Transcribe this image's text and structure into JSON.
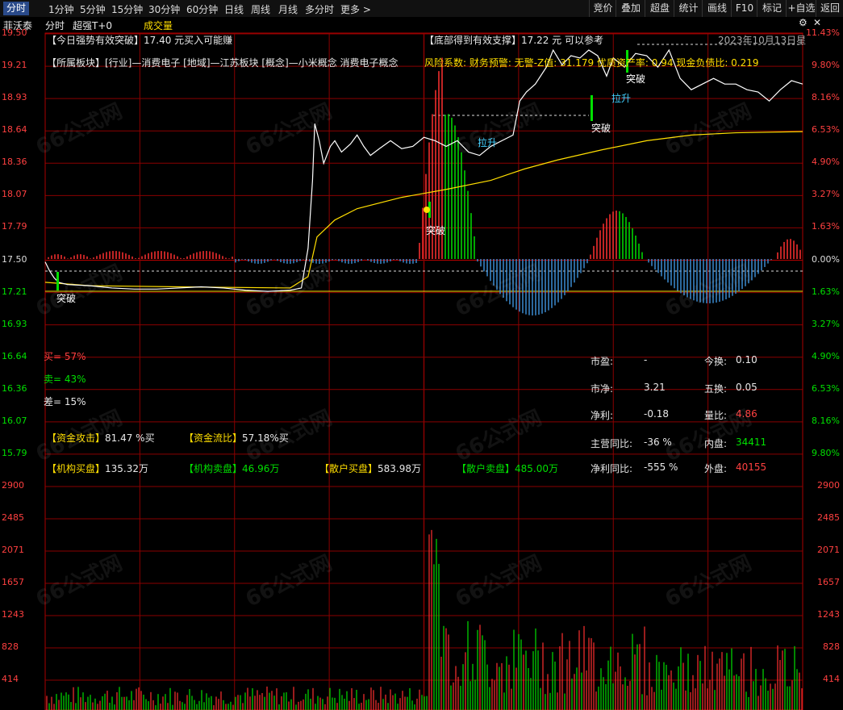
{
  "toolbar": {
    "tabs": [
      "分时",
      "1分钟",
      "5分钟",
      "15分钟",
      "30分钟",
      "60分钟",
      "日线",
      "周线",
      "月线",
      "多分时",
      "更多 >"
    ],
    "right_buttons": [
      "竞价",
      "叠加",
      "超盘",
      "统计",
      "画线",
      "F10",
      "标记",
      "+自选",
      "返回"
    ]
  },
  "subbar": {
    "stock": "菲沃泰",
    "mode": "分时",
    "indicator": "超强T+0",
    "volume_label": "成交量"
  },
  "icons": {
    "settings": "gear-icon",
    "close": "close-icon",
    "arrow": "chevron-right-icon"
  },
  "main": {
    "signal_left": "【今日强势有效突破】17.40 元买入可能赚",
    "signal_right": "【底部得到有效支撑】17.22 元 可以参考",
    "date": "2023年10月13日星",
    "sector": "【所属板块】[行业]—消费电子 [地域]—江苏板块 [概念]—小米概念 消费电子概念",
    "risk": "风险系数: 财务预警: 无警-Z值: 31.179 优质资产率: 0.94 现金负债比: 0.219",
    "breakout_labels": [
      "突破",
      "突破",
      "突破",
      "突破"
    ],
    "pull_labels": [
      "拉升",
      "拉升"
    ]
  },
  "price_axis": {
    "left": [
      "19.50",
      "19.21",
      "18.93",
      "18.64",
      "18.36",
      "18.07",
      "17.79",
      "17.50",
      "17.21",
      "16.93",
      "16.64",
      "16.36",
      "16.07",
      "15.79"
    ],
    "right": [
      "11.43%",
      "9.80%",
      "8.16%",
      "6.53%",
      "4.90%",
      "3.27%",
      "1.63%",
      "0.00%",
      "1.63%",
      "3.27%",
      "4.90%",
      "6.53%",
      "8.16%",
      "9.80%"
    ]
  },
  "volume_axis": [
    "2900",
    "2485",
    "2071",
    "1657",
    "1243",
    "828",
    "414"
  ],
  "stats": {
    "buy": "买= 57%",
    "sell": "卖= 43%",
    "diff": "差= 15%",
    "fund_attack": {
      "label": "【资金攻击】",
      "value": "81.47 %买"
    },
    "fund_flow": {
      "label": "【资金流比】",
      "value": "57.18%买"
    },
    "inst_buy": {
      "label": "【机构买盘】",
      "value": "135.32万"
    },
    "inst_sell": {
      "label": "【机构卖盘】",
      "value": "46.96万"
    },
    "retail_buy": {
      "label": "【散户买盘】",
      "value": "583.98万"
    },
    "retail_sell": {
      "label": "【散户卖盘】",
      "value": "485.00万"
    }
  },
  "fundamentals": [
    {
      "label": "市盈:",
      "value": "-",
      "label2": "今换:",
      "value2": "0.10"
    },
    {
      "label": "市净:",
      "value": "3.21",
      "label2": "五换:",
      "value2": "0.05"
    },
    {
      "label": "净利:",
      "value": "-0.18",
      "label2": "量比:",
      "value2": "4.86"
    },
    {
      "label": "主营同比:",
      "value": "-36 %",
      "label2": "内盘:",
      "value2": "34411"
    },
    {
      "label": "净利同比:",
      "value": "-555 %",
      "label2": "外盘:",
      "value2": "40155"
    }
  ],
  "watermark": "66公式网",
  "colors": {
    "up": "#ff3030",
    "down": "#00e000",
    "price_line": "#ffffff",
    "avg_line": "#ffde00",
    "grid": "#8a0000",
    "neg_bar": "#3a8ad0"
  },
  "chart_data": {
    "type": "line",
    "price_series": {
      "name": "",
      "points": [
        [
          0,
          17.48
        ],
        [
          2,
          17.4
        ],
        [
          4,
          17.34
        ],
        [
          6,
          17.3
        ],
        [
          10,
          17.28
        ],
        [
          20,
          17.27
        ],
        [
          30,
          17.25
        ],
        [
          40,
          17.24
        ],
        [
          50,
          17.24
        ],
        [
          60,
          17.25
        ],
        [
          70,
          17.26
        ],
        [
          80,
          17.25
        ],
        [
          90,
          17.23
        ],
        [
          100,
          17.22
        ],
        [
          110,
          17.23
        ],
        [
          115,
          17.25
        ],
        [
          118,
          17.6
        ],
        [
          120,
          18.2
        ],
        [
          121,
          18.7
        ],
        [
          123,
          18.55
        ],
        [
          125,
          18.35
        ],
        [
          128,
          18.5
        ],
        [
          130,
          18.55
        ],
        [
          133,
          18.45
        ],
        [
          137,
          18.52
        ],
        [
          140,
          18.6
        ],
        [
          143,
          18.5
        ],
        [
          146,
          18.42
        ],
        [
          150,
          18.48
        ],
        [
          155,
          18.55
        ],
        [
          160,
          18.48
        ],
        [
          165,
          18.5
        ],
        [
          170,
          18.58
        ],
        [
          175,
          18.55
        ],
        [
          180,
          18.5
        ],
        [
          185,
          18.55
        ],
        [
          190,
          18.45
        ],
        [
          195,
          18.42
        ],
        [
          200,
          18.5
        ],
        [
          205,
          18.55
        ],
        [
          210,
          18.6
        ],
        [
          213,
          18.9
        ],
        [
          216,
          18.98
        ],
        [
          220,
          19.05
        ],
        [
          225,
          19.2
        ],
        [
          228,
          19.35
        ],
        [
          232,
          19.22
        ],
        [
          236,
          19.3
        ],
        [
          240,
          19.28
        ],
        [
          244,
          19.35
        ],
        [
          248,
          19.3
        ],
        [
          252,
          19.12
        ],
        [
          255,
          19.28
        ],
        [
          260,
          19.2
        ],
        [
          265,
          19.32
        ],
        [
          270,
          19.3
        ],
        [
          275,
          19.2
        ],
        [
          280,
          19.35
        ],
        [
          285,
          19.1
        ],
        [
          290,
          19.0
        ],
        [
          295,
          19.05
        ],
        [
          300,
          19.1
        ],
        [
          305,
          19.05
        ],
        [
          310,
          19.05
        ],
        [
          315,
          19.0
        ],
        [
          320,
          18.98
        ],
        [
          325,
          18.9
        ],
        [
          330,
          19.0
        ],
        [
          335,
          19.08
        ],
        [
          340,
          19.05
        ]
      ]
    },
    "avg_series": {
      "name": "",
      "points": [
        [
          0,
          17.3
        ],
        [
          20,
          17.27
        ],
        [
          60,
          17.26
        ],
        [
          110,
          17.25
        ],
        [
          118,
          17.35
        ],
        [
          122,
          17.7
        ],
        [
          130,
          17.85
        ],
        [
          140,
          17.95
        ],
        [
          160,
          18.05
        ],
        [
          180,
          18.12
        ],
        [
          200,
          18.2
        ],
        [
          215,
          18.3
        ],
        [
          230,
          18.38
        ],
        [
          250,
          18.47
        ],
        [
          270,
          18.55
        ],
        [
          290,
          18.6
        ],
        [
          310,
          18.62
        ],
        [
          340,
          18.63
        ]
      ]
    },
    "ylim": [
      15.79,
      19.5
    ],
    "xlim": [
      0,
      340
    ],
    "volume_ylim": [
      0,
      2900
    ]
  }
}
